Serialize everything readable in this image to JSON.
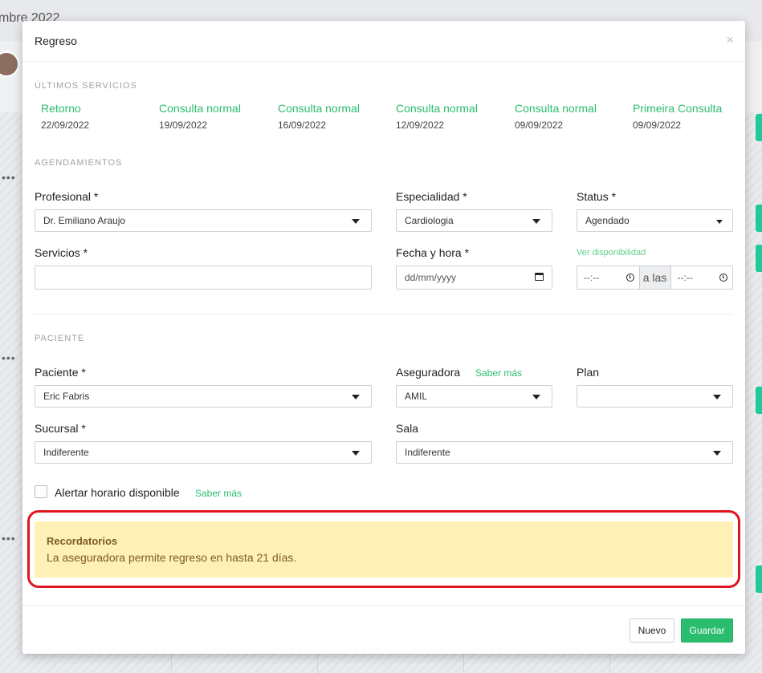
{
  "background": {
    "title": "mbre 2022"
  },
  "modal": {
    "title": "Regreso",
    "close_glyph": "×",
    "last_services_label": "ÚLTIMOS SERVICIOS",
    "last_services": [
      {
        "name": "Retorno",
        "date": "22/09/2022"
      },
      {
        "name": "Consulta normal",
        "date": "19/09/2022"
      },
      {
        "name": "Consulta normal",
        "date": "16/09/2022"
      },
      {
        "name": "Consulta normal",
        "date": "12/09/2022"
      },
      {
        "name": "Consulta normal",
        "date": "09/09/2022"
      },
      {
        "name": "Primeira Consulta",
        "date": "09/09/2022"
      }
    ],
    "scheduling": {
      "section_label": "AGENDAMIENTOS",
      "profesional_label": "Profesional *",
      "profesional_value": "Dr. Emiliano Araujo",
      "especialidad_label": "Especialidad *",
      "especialidad_value": "Cardiologia",
      "status_label": "Status *",
      "status_value": "Agendado",
      "servicios_label": "Servicios *",
      "servicios_value": "",
      "fecha_label": "Fecha y hora *",
      "fecha_placeholder": "dd/mm/yyyy",
      "ver_disponibilidad": "Ver disponibilidad",
      "time_start": "--:--",
      "time_separator": "a las",
      "time_end": "--:--"
    },
    "patient": {
      "section_label": "PACIENTE",
      "paciente_label": "Paciente *",
      "paciente_value": "Eric Fabris",
      "aseguradora_label": "Aseguradora",
      "aseguradora_link": "Saber más",
      "aseguradora_value": "AMIL",
      "plan_label": "Plan",
      "plan_value": "",
      "sucursal_label": "Sucursal *",
      "sucursal_value": "Indiferente",
      "sala_label": "Sala",
      "sala_value": "Indiferente",
      "alert_checkbox_label": "Alertar horario disponible",
      "alert_checkbox_link": "Saber más",
      "alert_checkbox_checked": false
    },
    "reminder": {
      "title": "Recordatorios",
      "text": "La aseguradora permite regreso en hasta 21 días."
    },
    "footer": {
      "new_label": "Nuevo",
      "save_label": "Guardar"
    }
  },
  "colors": {
    "accent_green": "#2bbd6e",
    "alert_bg": "#fff0b8",
    "alert_text": "#7a5c23",
    "highlight_outline": "#e0141f"
  }
}
